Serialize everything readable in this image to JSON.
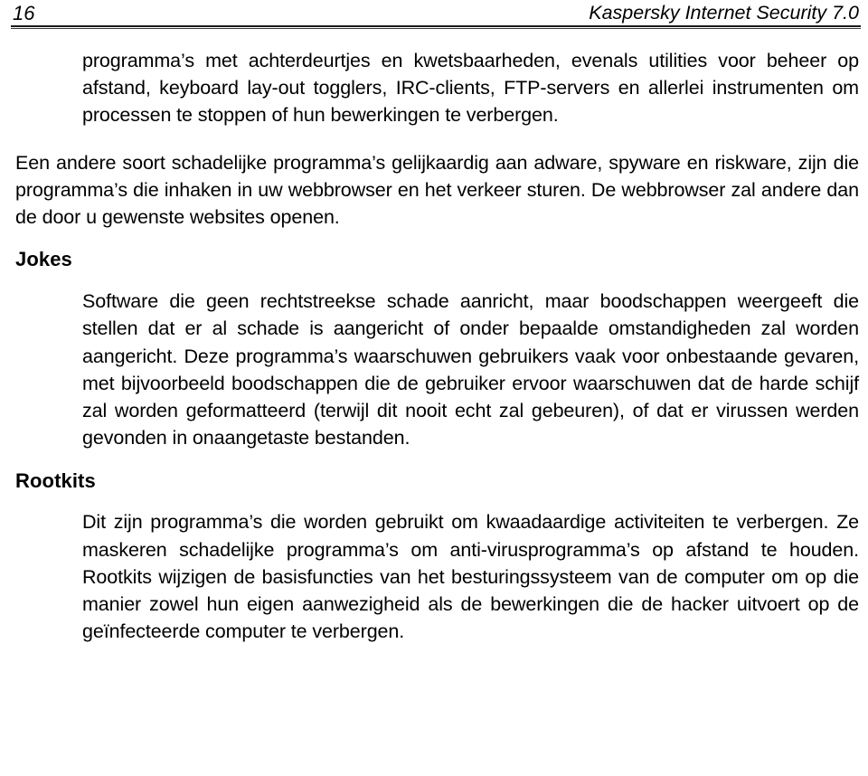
{
  "document": {
    "header": {
      "folio": "16",
      "title": "Kaspersky Internet Security 7.0"
    },
    "blocks": {
      "para_backdoors": "programma’s met achterdeurtjes en kwetsbaarheden, evenals utilities voor beheer op afstand, keyboard lay-out togglers, IRC-clients, FTP-servers en allerlei instrumenten om processen te stoppen of hun bewerkingen te verbergen.",
      "para_adware": "Een andere soort schadelijke programma’s gelijkaardig aan adware, spyware en riskware, zijn die programma’s die inhaken in uw webbrowser en het verkeer sturen. De webbrowser zal andere dan de door u gewenste websites openen.",
      "heading_jokes": "Jokes",
      "para_jokes": "Software die geen rechtstreekse schade aanricht, maar boodschappen weergeeft die stellen dat er al schade is aangericht of onder bepaalde omstandigheden zal worden aangericht. Deze programma’s waarschuwen gebruikers vaak voor onbestaande gevaren, met bijvoorbeeld boodschappen die de gebruiker ervoor waarschuwen dat de harde schijf zal worden geformatteerd (terwijl dit nooit echt zal gebeuren), of dat er virussen werden gevonden in onaangetaste bestanden.",
      "heading_rootkits": "Rootkits",
      "para_rootkits": "Dit zijn programma’s die worden gebruikt om kwaadaardige activiteiten te verbergen. Ze maskeren schadelijke programma’s om anti-virusprogramma’s op afstand te houden. Rootkits wijzigen de basisfuncties van het besturingssysteem van de computer om op die manier zowel hun eigen aanwezigheid als de bewerkingen die de hacker uitvoert op de geïnfecteerde computer te verbergen."
    },
    "colors": {
      "text": "#000000",
      "background": "#ffffff",
      "rule": "#1b1b1b"
    }
  }
}
